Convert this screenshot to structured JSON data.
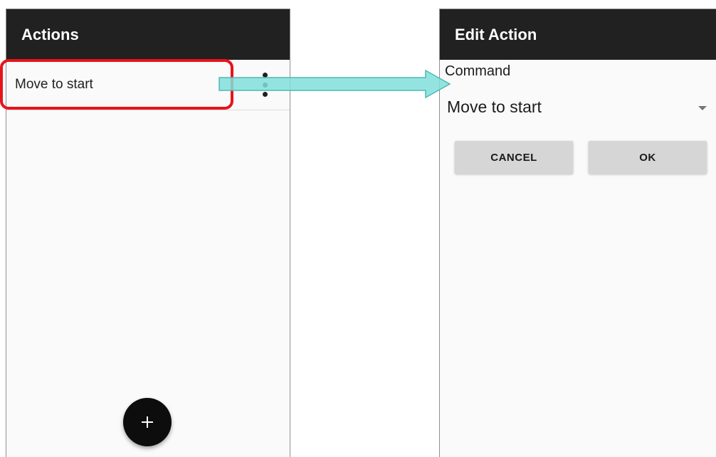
{
  "actions_screen": {
    "title": "Actions",
    "items": [
      {
        "label": "Move to start"
      }
    ],
    "fab_icon": "plus-icon",
    "overflow_icon": "more-vert-icon"
  },
  "edit_action_screen": {
    "title": "Edit Action",
    "command_label": "Command",
    "command_value": "Move to start",
    "cancel_label": "CANCEL",
    "ok_label": "OK"
  },
  "annotation": {
    "highlight_color": "#e8141b",
    "arrow_color": "#80dfdc"
  }
}
